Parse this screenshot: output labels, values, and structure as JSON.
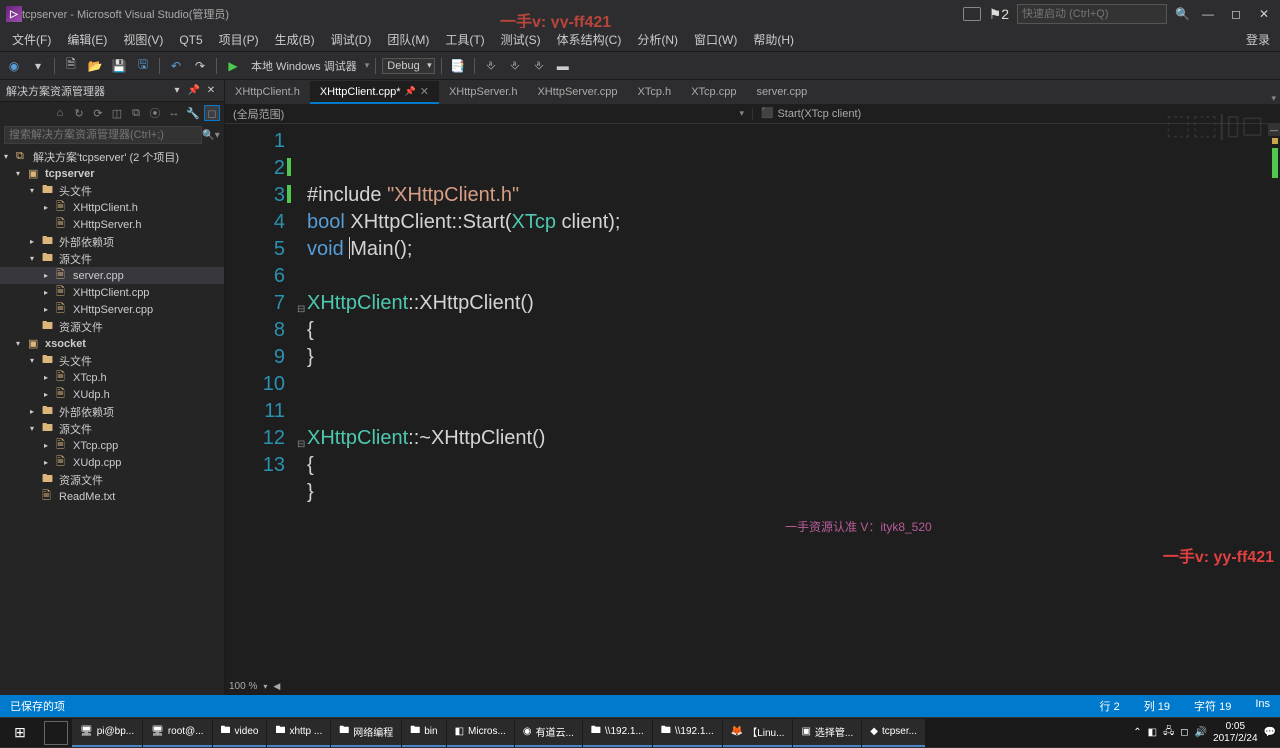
{
  "titlebar": {
    "title": "tcpserver - Microsoft Visual Studio(管理员)",
    "overlay": "一手v: yy-ff421",
    "flag_badge": "2",
    "search_placeholder": "快速启动 (Ctrl+Q)"
  },
  "menubar": {
    "items": [
      "文件(F)",
      "编辑(E)",
      "视图(V)",
      "QT5",
      "项目(P)",
      "生成(B)",
      "调试(D)",
      "团队(M)",
      "工具(T)",
      "测试(S)",
      "体系结构(C)",
      "分析(N)",
      "窗口(W)",
      "帮助(H)"
    ],
    "login": "登录"
  },
  "toolbar": {
    "debug_target": "本地 Windows 调试器",
    "config": "Debug"
  },
  "sidebar": {
    "title": "解决方案资源管理器",
    "search_placeholder": "搜索解决方案资源管理器(Ctrl+;)",
    "tree": [
      {
        "depth": 0,
        "expander": "▾",
        "icon": "⧉",
        "label": "解决方案'tcpserver' (2 个项目)"
      },
      {
        "depth": 1,
        "expander": "▾",
        "icon": "▣",
        "label": "tcpserver",
        "bold": true
      },
      {
        "depth": 2,
        "expander": "▾",
        "icon": "🖿",
        "label": "头文件"
      },
      {
        "depth": 3,
        "expander": "▸",
        "icon": "🗎",
        "label": "XHttpClient.h"
      },
      {
        "depth": 3,
        "expander": "",
        "icon": "🗎",
        "label": "XHttpServer.h"
      },
      {
        "depth": 2,
        "expander": "▸",
        "icon": "🖿",
        "label": "外部依赖项"
      },
      {
        "depth": 2,
        "expander": "▾",
        "icon": "🖿",
        "label": "源文件"
      },
      {
        "depth": 3,
        "expander": "▸",
        "icon": "🗎",
        "label": "server.cpp",
        "selected": true
      },
      {
        "depth": 3,
        "expander": "▸",
        "icon": "🗎",
        "label": "XHttpClient.cpp"
      },
      {
        "depth": 3,
        "expander": "▸",
        "icon": "🗎",
        "label": "XHttpServer.cpp"
      },
      {
        "depth": 2,
        "expander": "",
        "icon": "🖿",
        "label": "资源文件"
      },
      {
        "depth": 1,
        "expander": "▾",
        "icon": "▣",
        "label": "xsocket",
        "bold": true
      },
      {
        "depth": 2,
        "expander": "▾",
        "icon": "🖿",
        "label": "头文件"
      },
      {
        "depth": 3,
        "expander": "▸",
        "icon": "🗎",
        "label": "XTcp.h"
      },
      {
        "depth": 3,
        "expander": "▸",
        "icon": "🗎",
        "label": "XUdp.h"
      },
      {
        "depth": 2,
        "expander": "▸",
        "icon": "🖿",
        "label": "外部依赖项"
      },
      {
        "depth": 2,
        "expander": "▾",
        "icon": "🖿",
        "label": "源文件"
      },
      {
        "depth": 3,
        "expander": "▸",
        "icon": "🗎",
        "label": "XTcp.cpp"
      },
      {
        "depth": 3,
        "expander": "▸",
        "icon": "🗎",
        "label": "XUdp.cpp"
      },
      {
        "depth": 2,
        "expander": "",
        "icon": "🖿",
        "label": "资源文件"
      },
      {
        "depth": 2,
        "expander": "",
        "icon": "🗎",
        "label": "ReadMe.txt"
      }
    ]
  },
  "tabs": [
    {
      "label": "XHttpClient.h"
    },
    {
      "label": "XHttpClient.cpp*",
      "active": true,
      "pinned": true
    },
    {
      "label": "XHttpServer.h"
    },
    {
      "label": "XHttpServer.cpp"
    },
    {
      "label": "XTcp.h"
    },
    {
      "label": "XTcp.cpp"
    },
    {
      "label": "server.cpp"
    }
  ],
  "scope": {
    "left": "(全局范围)",
    "right": "Start(XTcp client)"
  },
  "code": {
    "lines": [
      {
        "n": 1,
        "html": "<span class='txt'>#include </span><span class='kw-str'>\"XHttpClient.h\"</span>"
      },
      {
        "n": 2,
        "mark": true,
        "html": "<span class='kw-blue'>bool</span><span class='txt'> XHttpClient::Start(</span><span class='kw-teal'>XTcp</span><span class='txt'> client);</span>"
      },
      {
        "n": 3,
        "mark": true,
        "html": "<span class='kw-blue'>void</span><span class='txt'> </span><span class='caret'></span><span class='txt'>Main();</span>"
      },
      {
        "n": 4,
        "html": ""
      },
      {
        "n": 5,
        "fold": true,
        "html": "<span class='kw-teal'>XHttpClient</span><span class='txt'>::XHttpClient()</span>"
      },
      {
        "n": 6,
        "html": "<span class='txt'>{</span>"
      },
      {
        "n": 7,
        "html": "<span class='txt'>}</span>"
      },
      {
        "n": 8,
        "html": ""
      },
      {
        "n": 9,
        "html": ""
      },
      {
        "n": 10,
        "fold": true,
        "html": "<span class='kw-teal'>XHttpClient</span><span class='txt'>::~XHttpClient()</span>"
      },
      {
        "n": 11,
        "html": "<span class='txt'>{</span>"
      },
      {
        "n": 12,
        "html": "<span class='txt'>}</span>"
      },
      {
        "n": 13,
        "html": ""
      }
    ],
    "zoom": "100 %"
  },
  "overlays": {
    "watermark1": "一手资源认准 V：ityk8_520",
    "watermark2": "一手v: yy-ff421",
    "faint": "⬚⬚|▯◻"
  },
  "statusbar": {
    "left": "已保存的项",
    "line": "行 2",
    "col": "列 19",
    "char": "字符 19",
    "ins": "Ins"
  },
  "taskbar": {
    "items": [
      {
        "icon": "🖥",
        "label": "pi@bp..."
      },
      {
        "icon": "🖥",
        "label": "root@..."
      },
      {
        "icon": "🖿",
        "label": "video"
      },
      {
        "icon": "🖿",
        "label": "xhttp ..."
      },
      {
        "icon": "🖿",
        "label": "网络编程"
      },
      {
        "icon": "🖿",
        "label": "bin"
      },
      {
        "icon": "◧",
        "label": "Micros..."
      },
      {
        "icon": "◉",
        "label": "有道云..."
      },
      {
        "icon": "🖿",
        "label": "\\\\192.1..."
      },
      {
        "icon": "🖿",
        "label": "\\\\192.1..."
      },
      {
        "icon": "🦊",
        "label": "【Linu..."
      },
      {
        "icon": "▣",
        "label": "选择管..."
      },
      {
        "icon": "◆",
        "label": "tcpser..."
      }
    ],
    "time": "0:05",
    "date": "2017/2/24"
  }
}
